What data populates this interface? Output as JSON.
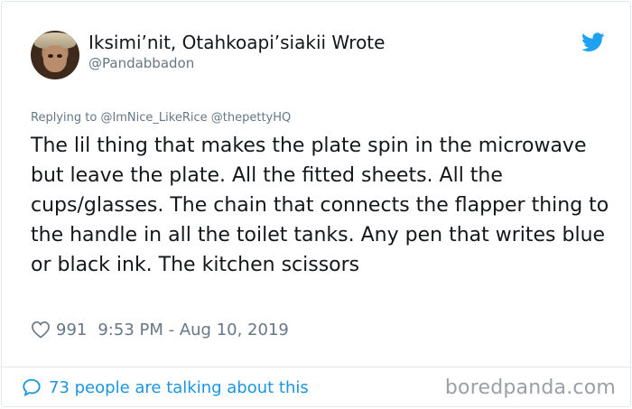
{
  "author": {
    "display_name": "Iksimi’nit, Otahkoapi’siakii Wrote",
    "screen_name": "@Pandabbadon"
  },
  "reply": {
    "prefix": "Replying to",
    "mentions": "@ImNice_LikeRice @thepettyHQ"
  },
  "tweet": {
    "text": "The lil thing that makes the plate spin in the microwave but leave the plate. All the fitted sheets. All the cups/glasses. The chain that connects the flapper thing to the handle in all the toilet tanks. Any pen that writes blue or black ink. The kitchen scissors"
  },
  "meta": {
    "likes": "991",
    "timestamp": "9:53 PM - Aug 10, 2019"
  },
  "footer": {
    "talking": "73 people are talking about this"
  },
  "watermark": "boredpanda.com",
  "colors": {
    "twitter_blue": "#1da1f2",
    "link_blue": "#1b95e0",
    "secondary_text": "#657786"
  },
  "icons": [
    "avatar",
    "twitter-bird-icon",
    "heart-icon",
    "speech-bubble-icon"
  ]
}
